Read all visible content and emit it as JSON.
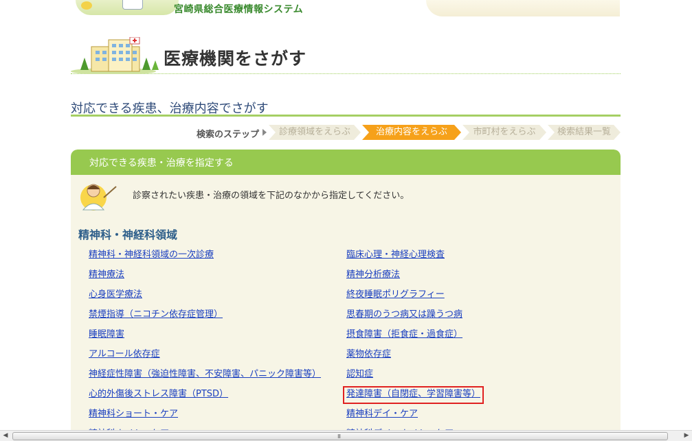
{
  "banner": {
    "system_title": "宮崎県総合医療情報システム"
  },
  "page": {
    "title": "医療機関をさがす",
    "section_title": "対応できる疾患、治療内容でさがす"
  },
  "steps": {
    "label": "検索のステップ",
    "items": [
      {
        "label": "診療領域をえらぶ",
        "active": false
      },
      {
        "label": "治療内容をえらぶ",
        "active": true
      },
      {
        "label": "市町村をえらぶ",
        "active": false
      },
      {
        "label": "検索結果一覧",
        "active": false
      }
    ]
  },
  "panel": {
    "header": "対応できる疾患・治療を指定する",
    "intro": "診察されたい疾患・治療の領域を下記のなかから指定してください。",
    "category": "精神科・神経科領域",
    "left_links": [
      "精神科・神経科領域の一次診療",
      "精神療法",
      "心身医学療法",
      "禁煙指導（ニコチン依存症管理）",
      "睡眠障害",
      "アルコール依存症",
      "神経症性障害（強迫性障害、不安障害、パニック障害等）",
      "心的外傷後ストレス障害（PTSD）",
      "精神科ショート・ケア",
      "精神科ナイト・ケア"
    ],
    "right_links": [
      "臨床心理・神経心理検査",
      "精神分析療法",
      "終夜睡眠ポリグラフィー",
      "思春期のうつ病又は躁うつ病",
      "摂食障害（拒食症・過食症）",
      "薬物依存症",
      "認知症",
      "発達障害（自閉症、学習障害等）",
      "精神科デイ・ケア",
      "精神科デイ・ナイト・ケア"
    ],
    "highlighted_right_index": 7
  },
  "colors": {
    "accent_green": "#97c94f",
    "active_step": "#f6a11a",
    "link": "#1a3fc0",
    "highlight_border": "#e02020"
  },
  "scrollbar": {
    "left_arrow": "◀",
    "right_arrow": "▶",
    "grip": "III"
  }
}
